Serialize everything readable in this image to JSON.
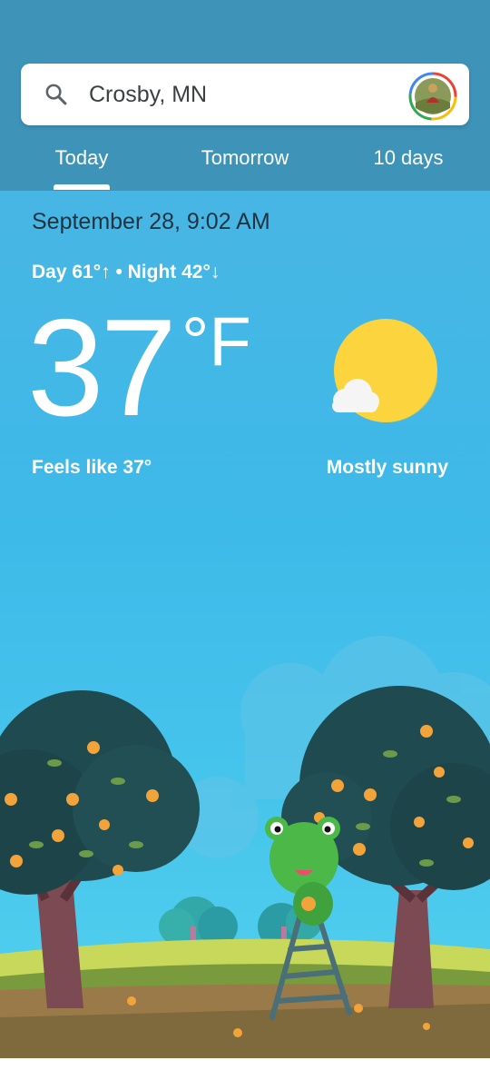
{
  "search": {
    "location": "Crosby, MN",
    "icon": "search-icon"
  },
  "tabs": [
    {
      "label": "Today",
      "active": true
    },
    {
      "label": "Tomorrow",
      "active": false
    },
    {
      "label": "10 days",
      "active": false
    }
  ],
  "current": {
    "datetime": "September 28, 9:02 AM",
    "day_night": "Day 61°↑ • Night 42°↓",
    "temperature": "37",
    "unit": "°F",
    "feels_like": "Feels like 37°",
    "condition": "Mostly sunny",
    "condition_icon": "sun-cloud-icon"
  },
  "colors": {
    "header": "#3e93b9",
    "sky_top": "#48b6e4",
    "sun": "#fbd43e",
    "tree": "#1e4a4f"
  }
}
